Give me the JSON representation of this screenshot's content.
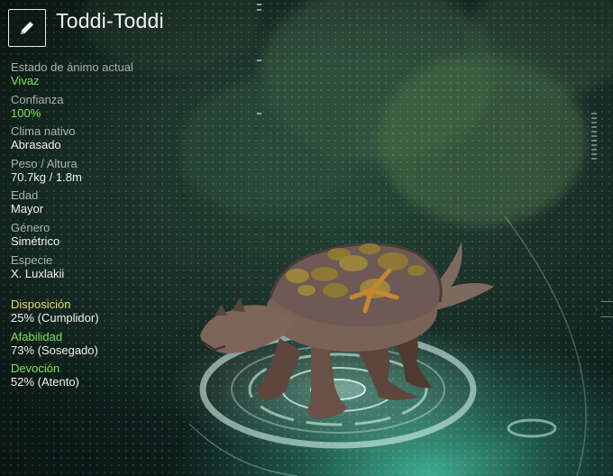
{
  "creature": {
    "name": "Toddi-Toddi"
  },
  "icons": {
    "edit": "pencil-icon"
  },
  "stats": [
    {
      "label": "Estado de ánimo actual",
      "value": "Vivaz",
      "highlight": true
    },
    {
      "label": "Confianza",
      "value": "100%",
      "highlight": true
    },
    {
      "label": "Clima nativo",
      "value": "Abrasado",
      "highlight": false
    },
    {
      "label": "Peso / Altura",
      "value": "70.7kg / 1.8m",
      "highlight": false
    },
    {
      "label": "Edad",
      "value": "Mayor",
      "highlight": false
    },
    {
      "label": "Género",
      "value": "Simétrico",
      "highlight": false
    },
    {
      "label": "Especie",
      "value": "X. Luxlakii",
      "highlight": false
    }
  ],
  "traits": [
    {
      "label": "Disposición",
      "value": "25% (Cumplidor)",
      "color": "#e8d86a"
    },
    {
      "label": "Afabilidad",
      "value": "73% (Sosegado)",
      "color": "#7fe35a"
    },
    {
      "label": "Devoción",
      "value": "52% (Atento)",
      "color": "#7fe35a"
    }
  ],
  "colors": {
    "accent_green": "#7fe35a",
    "accent_yellow": "#e8d86a",
    "label_gray": "#a9b3b0",
    "text_white": "#f0f0f0"
  }
}
